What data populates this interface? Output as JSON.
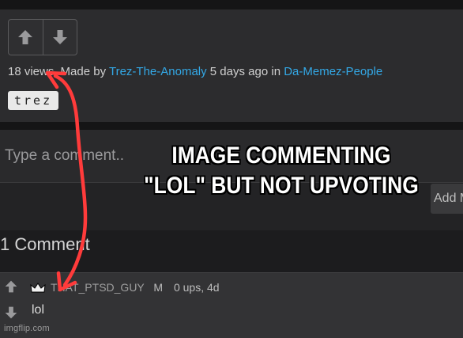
{
  "post": {
    "views": "18 views",
    "made_by_label": "Made by",
    "author": "Trez-The-Anomaly",
    "time_ago": "5 days ago",
    "in_label": "in",
    "stream": "Da-Memez-People",
    "tag": "trez"
  },
  "comment_box": {
    "placeholder": "Type a comment..",
    "post_button_label": "Add M"
  },
  "comments": {
    "count_label": "1 Comment",
    "items": [
      {
        "username": "THAT_PTSD_GUY",
        "badge": "M",
        "stats": "0 ups, 4d",
        "text": "lol"
      }
    ]
  },
  "meme": {
    "caption_line1": "IMAGE COMMENTING",
    "caption_line2": "\"LOL\" BUT NOT UPVOTING"
  },
  "watermark": "imgflip.com",
  "colors": {
    "link": "#33a8e6",
    "arrow": "#ff3b3b",
    "background": "#1c1c1e"
  },
  "icons": [
    "upvote-icon",
    "downvote-icon",
    "crown-icon"
  ]
}
